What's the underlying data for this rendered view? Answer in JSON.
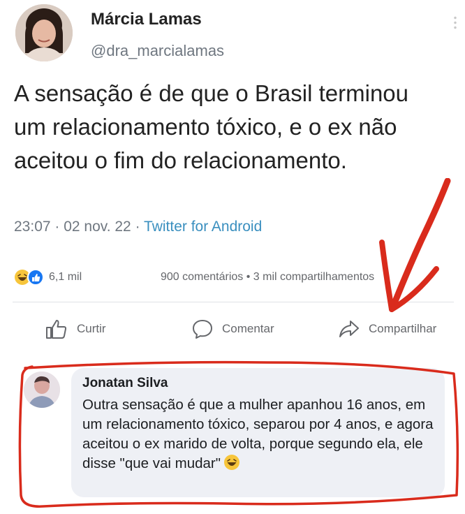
{
  "post": {
    "author_name": "Márcia Lamas",
    "author_handle": "@dra_marcialamas",
    "text": "A sensação é de que o Brasil terminou um relacionamento tóxico, e o ex não aceitou o fim do relacionamento.",
    "time_date": "23:07 · 02 nov. 22 · ",
    "source": "Twitter for Android"
  },
  "stats": {
    "reaction_icons": [
      "laugh-emoji",
      "like-icon"
    ],
    "reactions_count": "6,1 mil",
    "comments_shares": "900 comentários • 3 mil compartilhamentos"
  },
  "actions": {
    "like_label": "Curtir",
    "comment_label": "Comentar",
    "share_label": "Compartilhar"
  },
  "comment": {
    "author_name": "Jonatan Silva",
    "text": "Outra sensação é que a mulher apanhou 16 anos, em um relacionamento tóxico, separou por 4 anos, e agora aceitou o ex marido de volta, porque segundo ela, ele disse \"que vai mudar\"",
    "emoji": "laugh-emoji"
  },
  "colors": {
    "source_link": "#3a8fbf",
    "annotation_red": "#d92b1c",
    "comment_bubble": "#eef0f5",
    "like_blue": "#1877f2"
  }
}
